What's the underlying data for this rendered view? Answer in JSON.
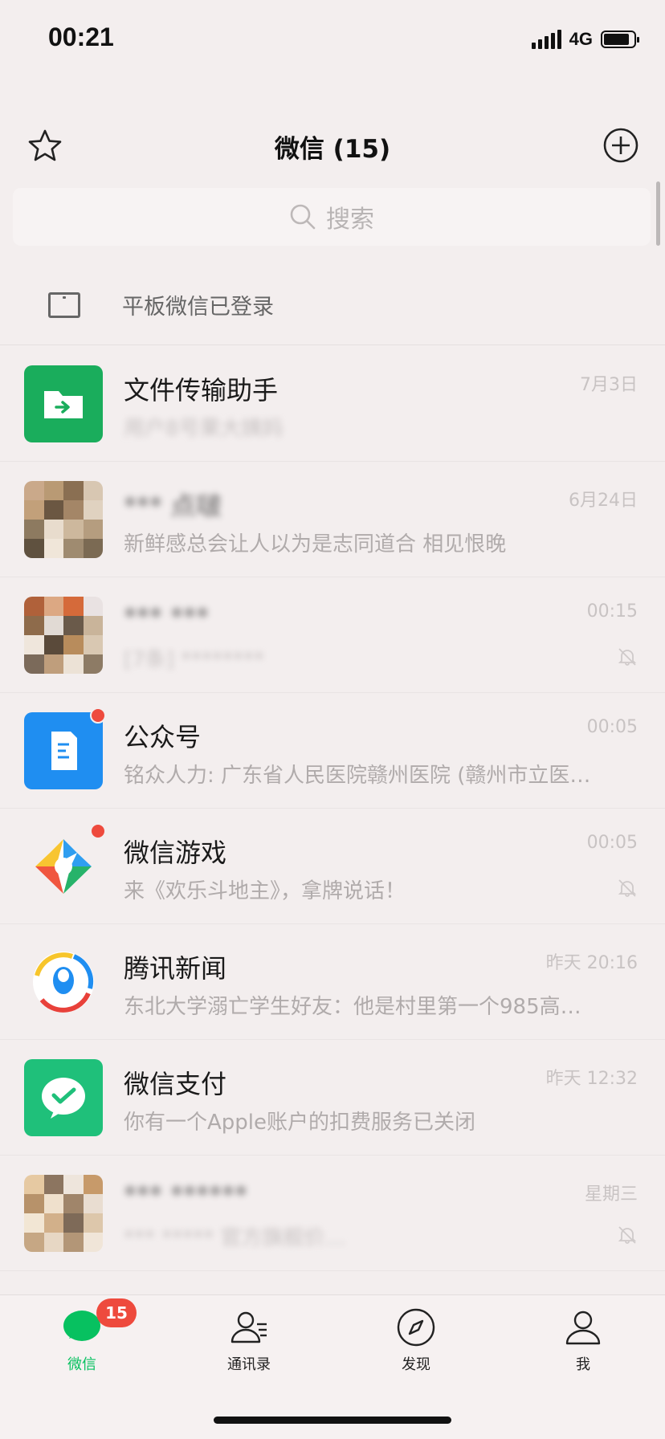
{
  "status_bar": {
    "time": "00:21",
    "network": "4G",
    "battery_level": 0.85
  },
  "header": {
    "title": "微信 (15)",
    "star_icon": "star-icon",
    "add_icon": "plus-circle-icon"
  },
  "search": {
    "placeholder": "搜索",
    "icon": "search-icon"
  },
  "tablet_banner": {
    "text": "平板微信已登录",
    "icon": "tablet-icon"
  },
  "chats": [
    {
      "name": "文件传输助手",
      "message": "用户8号果大姨妈",
      "time": "7月3日",
      "muted": false,
      "unread_dot": false,
      "avatar": "file-transfer-icon",
      "color": "#1aad5c"
    },
    {
      "name": "*** 点啵",
      "message": "新鲜感总会让人以为是志同道合 相见恨晚",
      "time": "6月24日",
      "muted": false,
      "unread_dot": false,
      "avatar": "photo-avatar"
    },
    {
      "name": "*** ***",
      "message": "[7条] ********",
      "time": "00:15",
      "muted": true,
      "unread_dot": false,
      "avatar": "group-avatar"
    },
    {
      "name": "公众号",
      "message": "铭众人力: 广东省人民医院赣州医院 (赣州市立医…",
      "time": "00:05",
      "muted": false,
      "unread_dot": true,
      "avatar": "official-accounts-icon",
      "color": "#1f8ef1"
    },
    {
      "name": "微信游戏",
      "message": "来《欢乐斗地主》，拿牌说话！",
      "time": "00:05",
      "muted": true,
      "unread_dot": true,
      "avatar": "wechat-games-icon"
    },
    {
      "name": "腾讯新闻",
      "message": "东北大学溺亡学生好友：他是村里第一个985高…",
      "time": "昨天 20:16",
      "muted": false,
      "unread_dot": false,
      "avatar": "tencent-news-icon"
    },
    {
      "name": "微信支付",
      "message": "你有一个Apple账户的扣费服务已关闭",
      "time": "昨天 12:32",
      "muted": false,
      "unread_dot": false,
      "avatar": "wechat-pay-icon",
      "color": "#1fc07a"
    },
    {
      "name": "*** ******",
      "message": "*** ***** 官方旗舰价…",
      "time": "星期三",
      "muted": true,
      "unread_dot": false,
      "avatar": "group-avatar"
    }
  ],
  "tab_bar": {
    "badge": "15",
    "tabs": [
      {
        "label": "微信",
        "icon": "chat-bubble-icon",
        "active": true
      },
      {
        "label": "通讯录",
        "icon": "contacts-icon",
        "active": false
      },
      {
        "label": "发现",
        "icon": "compass-icon",
        "active": false
      },
      {
        "label": "我",
        "icon": "person-icon",
        "active": false
      }
    ]
  },
  "colors": {
    "accent": "#07c160",
    "badge": "#ee4a3d",
    "background": "#f3eeee"
  }
}
